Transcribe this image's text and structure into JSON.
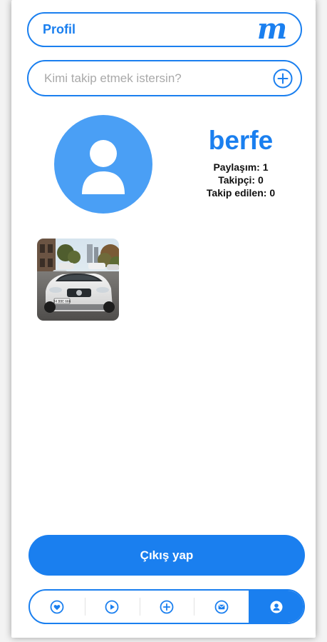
{
  "header": {
    "title": "Profil",
    "logo_text": "m"
  },
  "search": {
    "value": "",
    "placeholder": "Kimi takip etmek istersin?"
  },
  "profile": {
    "username": "berfe",
    "posts_label": "Paylaşım: 1",
    "followers_label": "Takipçi: 0",
    "following_label": "Takip edilen: 0"
  },
  "posts": {
    "plate_text": "34 BBE 666"
  },
  "actions": {
    "logout_label": "Çıkış yap"
  },
  "bottom_nav": {
    "items": [
      {
        "icon": "heart-icon"
      },
      {
        "icon": "play-icon"
      },
      {
        "icon": "plus-icon"
      },
      {
        "icon": "mail-icon"
      },
      {
        "icon": "user-icon",
        "active": true
      }
    ]
  },
  "colors": {
    "accent": "#1a7fef",
    "avatar": "#4a9ff5",
    "text": "#111111",
    "placeholder": "#a9a9a9"
  }
}
